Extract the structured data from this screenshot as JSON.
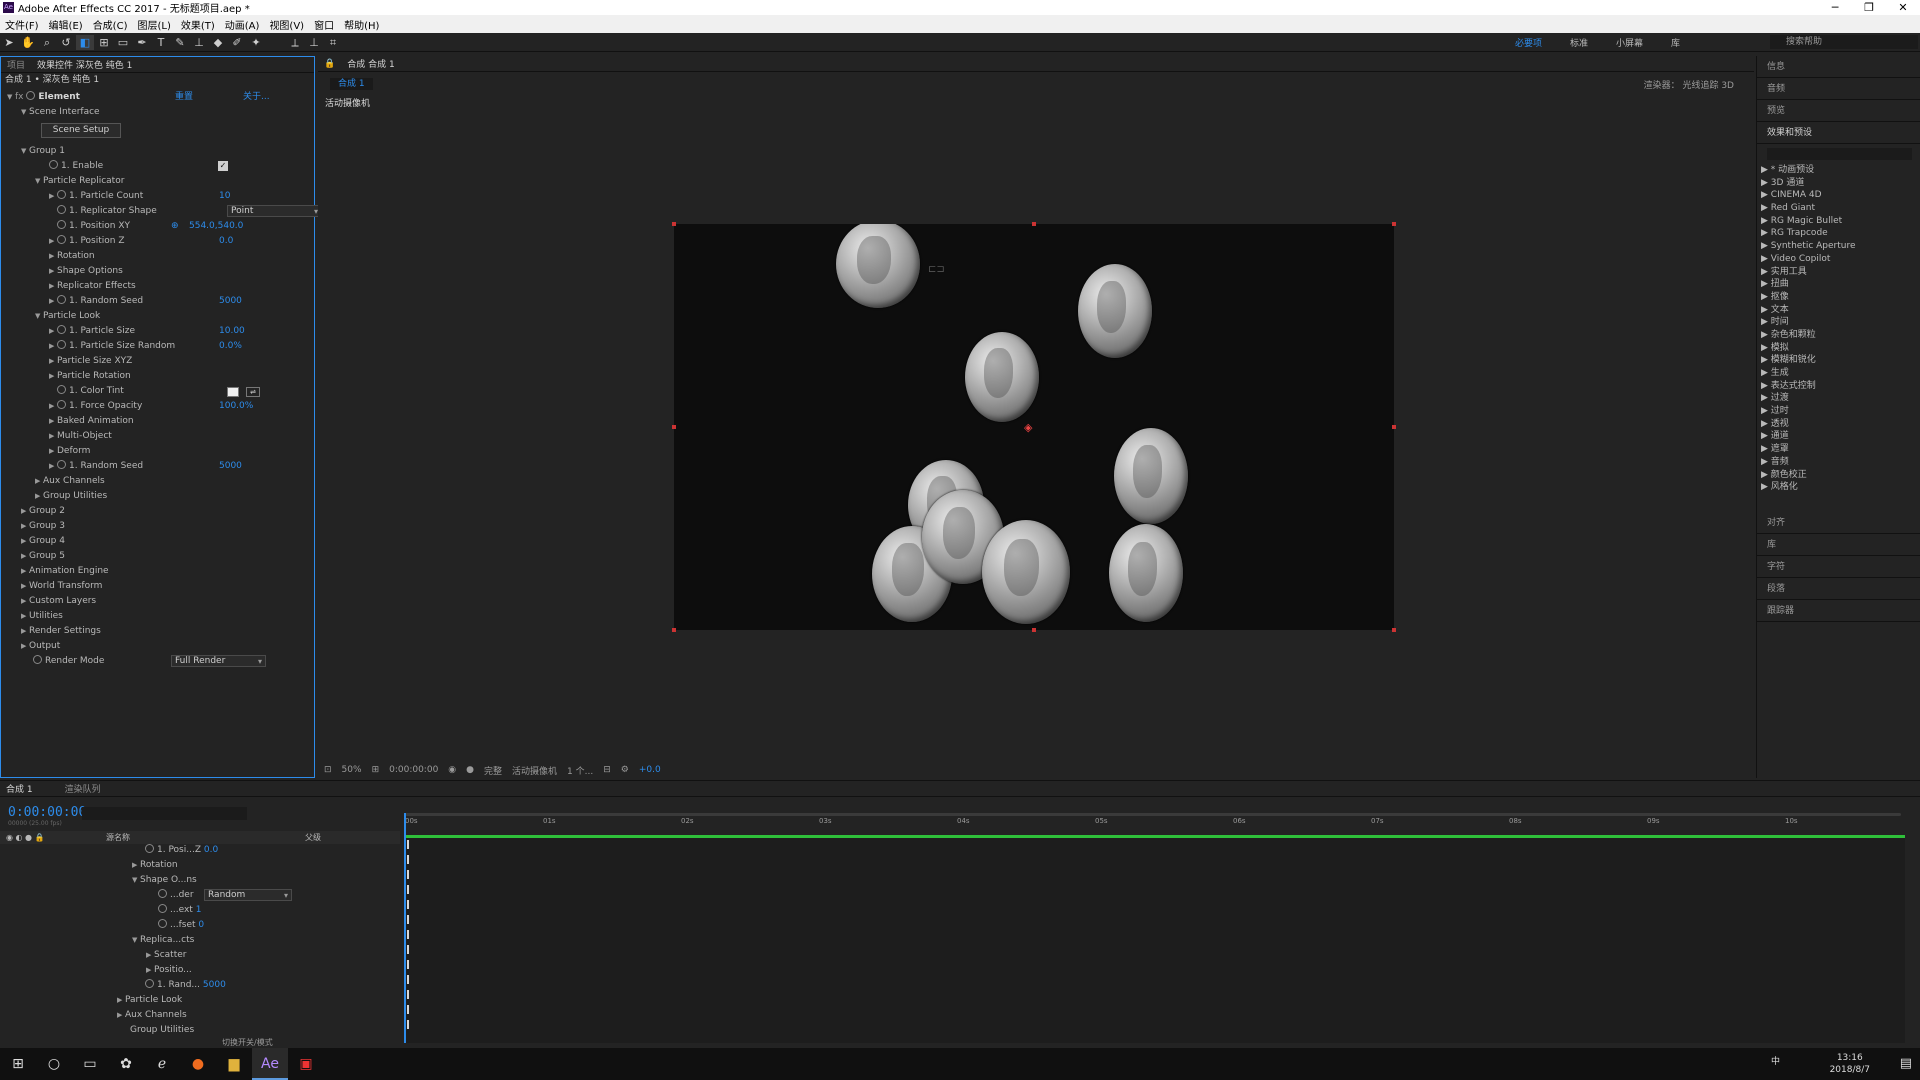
{
  "window": {
    "title": "Adobe After Effects CC 2017 - 无标题项目.aep *",
    "minimize": "─",
    "maximize": "❐",
    "close": "✕"
  },
  "menu": [
    "文件(F)",
    "编辑(E)",
    "合成(C)",
    "图层(L)",
    "效果(T)",
    "动画(A)",
    "视图(V)",
    "窗口",
    "帮助(H)"
  ],
  "workspaces": [
    "必要项",
    "标准",
    "小屏幕",
    "库"
  ],
  "help_search": "搜索帮助",
  "effect_controls": {
    "tabs": [
      "项目",
      "效果控件 深灰色 纯色 1"
    ],
    "breadcrumb": "合成 1 • 深灰色 纯色 1",
    "effect_name": "Element",
    "reset": "重置",
    "about": "关于...",
    "rows": {
      "scene_interface": "Scene Interface",
      "scene_setup_btn": "Scene Setup",
      "group1": "Group 1",
      "enable": "1. Enable",
      "particle_replicator": "Particle Replicator",
      "particle_count": "1. Particle Count",
      "particle_count_val": "10",
      "replicator_shape": "1. Replicator Shape",
      "replicator_shape_val": "Point",
      "position_xy": "1. Position XY",
      "position_xy_val": "554.0,540.0",
      "position_z": "1. Position Z",
      "position_z_val": "0.0",
      "rotation": "Rotation",
      "shape_options": "Shape Options",
      "replicator_effects": "Replicator Effects",
      "random_seed": "1. Random Seed",
      "random_seed_val": "5000",
      "particle_look": "Particle Look",
      "particle_size": "1. Particle Size",
      "particle_size_val": "10.00",
      "particle_size_random": "1. Particle Size Random",
      "particle_size_random_val": "0.0%",
      "particle_size_xyz": "Particle Size XYZ",
      "particle_rotation": "Particle Rotation",
      "color_tint": "1. Color Tint",
      "force_opacity": "1. Force Opacity",
      "force_opacity_val": "100.0%",
      "baked_animation": "Baked Animation",
      "multi_object": "Multi-Object",
      "deform": "Deform",
      "random_seed2": "1. Random Seed",
      "random_seed2_val": "5000",
      "aux_channels": "Aux Channels",
      "group_utilities": "Group Utilities",
      "group2": "Group 2",
      "group3": "Group 3",
      "group4": "Group 4",
      "group5": "Group 5",
      "animation_engine": "Animation Engine",
      "world_transform": "World Transform",
      "custom_layers": "Custom Layers",
      "utilities": "Utilities",
      "render_settings": "Render Settings",
      "output": "Output",
      "render_mode": "Render Mode",
      "render_mode_val": "Full Render"
    }
  },
  "composition": {
    "tab": "合成 合成 1",
    "subtab": "合成 1",
    "renderer": "渲染器： 光线追踪 3D",
    "camera_label": "活动摄像机",
    "zoom": "50%",
    "timecode": "0:00:00:00",
    "quality": "完整",
    "view": "活动摄像机",
    "views": "1 个...",
    "exposure": "+0.0"
  },
  "right_panel": {
    "sections_top": [
      "信息",
      "音频",
      "预览"
    ],
    "effects_title": "效果和预设",
    "effects": [
      "* 动画预设",
      "3D 通道",
      "CINEMA 4D",
      "Red Giant",
      "RG Magic Bullet",
      "RG Trapcode",
      "Synthetic Aperture",
      "Video Copilot",
      "实用工具",
      "扭曲",
      "抠像",
      "文本",
      "时间",
      "杂色和颗粒",
      "模拟",
      "模糊和锐化",
      "生成",
      "表达式控制",
      "过渡",
      "过时",
      "透视",
      "通道",
      "遮罩",
      "音频",
      "颜色校正",
      "风格化"
    ],
    "sections_bottom": [
      "对齐",
      "库",
      "字符",
      "段落",
      "跟踪器"
    ]
  },
  "timeline": {
    "tabs": [
      "合成 1",
      "渲染队列"
    ],
    "timecode": "0:00:00:00",
    "timecode_sub": "00000 (25.00 fps)",
    "col_source": "源名称",
    "col_parent": "父级",
    "ruler": [
      "00s",
      "01s",
      "02s",
      "03s",
      "04s",
      "05s",
      "06s",
      "07s",
      "08s",
      "09s",
      "10s"
    ],
    "rows": [
      {
        "label": "1. Posi...Z",
        "val": "0.0"
      },
      {
        "label": "Rotation",
        "val": ""
      },
      {
        "label": "Shape O...ns",
        "val": ""
      },
      {
        "label": "...der",
        "val": "Random"
      },
      {
        "label": "...ext",
        "val": "1"
      },
      {
        "label": "...fset",
        "val": "0"
      },
      {
        "label": "Replica...cts",
        "val": ""
      },
      {
        "label": "Scatter",
        "val": ""
      },
      {
        "label": "Positio...",
        "val": ""
      },
      {
        "label": "1. Rand...",
        "val": "5000"
      },
      {
        "label": "Particle Look",
        "val": ""
      },
      {
        "label": "Aux Channels",
        "val": ""
      },
      {
        "label": "Group Utilities",
        "val": ""
      }
    ],
    "footer": "切换开关/模式"
  },
  "taskbar": {
    "time": "13:16",
    "date": "2018/8/7",
    "ime": "中"
  },
  "colors": {
    "accent": "#2d8ceb",
    "panel": "#232323",
    "handle": "#cc3333"
  }
}
